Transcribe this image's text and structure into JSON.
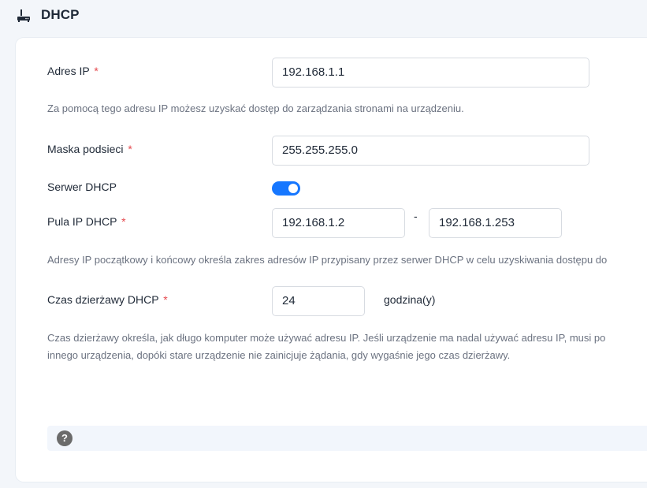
{
  "header": {
    "title": "DHCP",
    "icon": "router-icon"
  },
  "form": {
    "ip_address": {
      "label": "Adres IP",
      "required_mark": "*",
      "value": "192.168.1.1",
      "help": "Za pomocą tego adresu IP możesz uzyskać dostęp do zarządzania stronami na urządzeniu."
    },
    "subnet_mask": {
      "label": "Maska podsieci",
      "required_mark": "*",
      "value": "255.255.255.0"
    },
    "dhcp_server": {
      "label": "Serwer DHCP",
      "enabled": true
    },
    "ip_pool": {
      "label": "Pula IP DHCP",
      "required_mark": "*",
      "start": "192.168.1.2",
      "separator": "-",
      "end": "192.168.1.253",
      "help": "Adresy IP początkowy i końcowy określa zakres adresów IP przypisany przez serwer DHCP w celu uzyskiwania dostępu do"
    },
    "lease_time": {
      "label": "Czas dzierżawy DHCP",
      "required_mark": "*",
      "value": "24",
      "unit": "godzina(y)",
      "help_line1": "Czas dzierżawy określa, jak długo komputer może używać adresu IP. Jeśli urządzenie ma nadal używać adresu IP, musi po",
      "help_line2": "innego urządzenia, dopóki stare urządzenie nie zainicjuje żądania, gdy wygaśnie jego czas dzierżawy."
    }
  },
  "tip": {
    "icon": "question-icon",
    "icon_glyph": "?"
  },
  "colors": {
    "accent": "#1677ff",
    "required": "#e5484d",
    "background": "#f3f6fa"
  }
}
